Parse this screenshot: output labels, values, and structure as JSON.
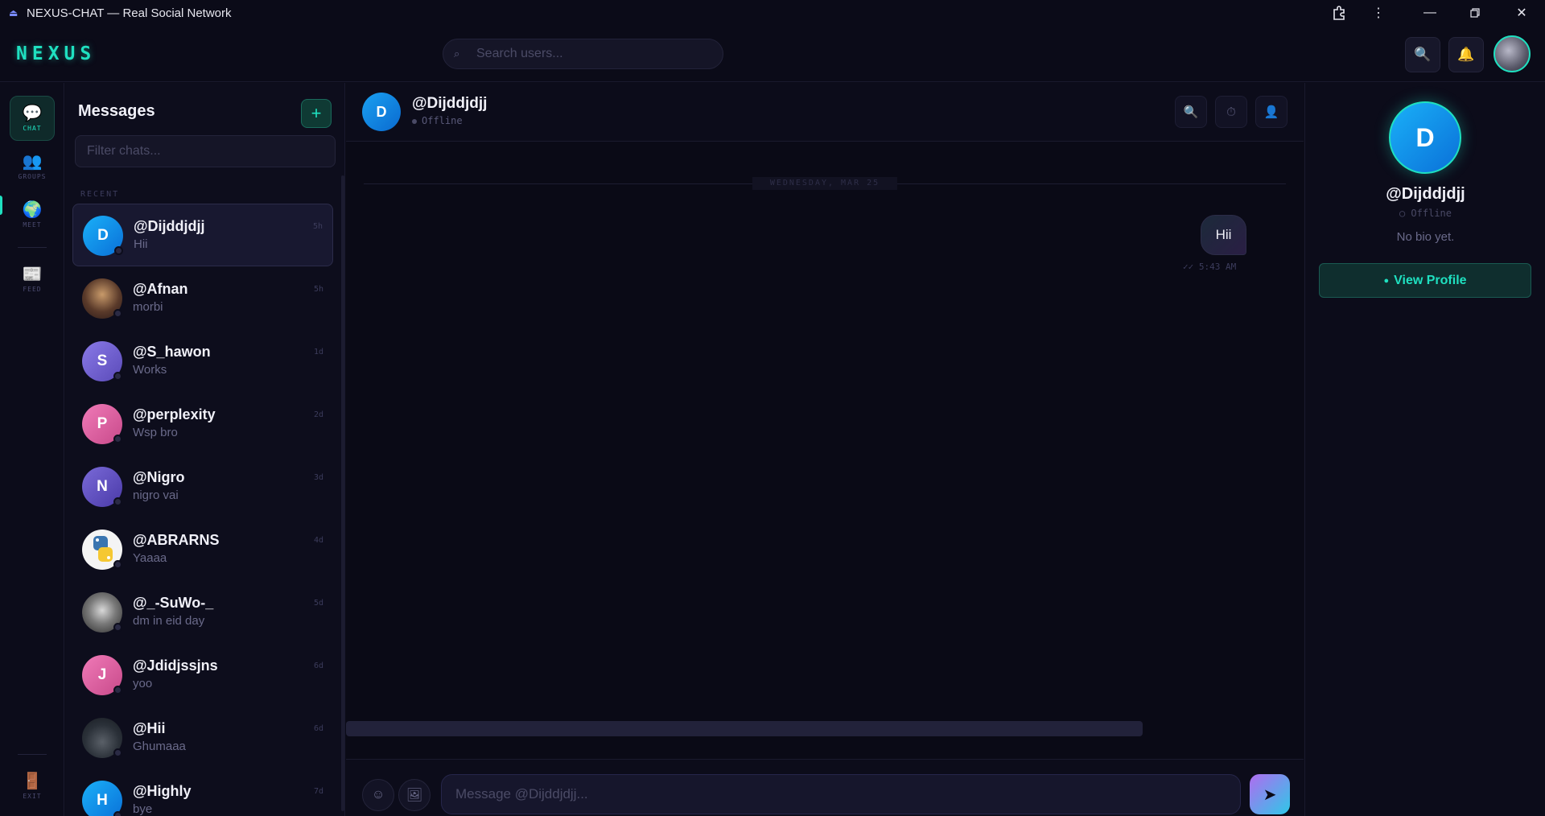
{
  "window": {
    "title": "NEXUS-CHAT — Real Social Network"
  },
  "header": {
    "logo": "NEXUS",
    "search_placeholder": "Search users...",
    "buttons": [
      "search-icon",
      "bell-icon"
    ]
  },
  "rail": {
    "items": [
      {
        "label": "CHAT",
        "icon": "speech-bubble-icon",
        "active": true
      },
      {
        "label": "GROUPS",
        "icon": "people-icon",
        "active": false
      },
      {
        "label": "MEET",
        "icon": "globe-icon",
        "active": false
      },
      {
        "label": "FEED",
        "icon": "newspaper-icon",
        "active": false
      },
      {
        "label": "EXIT",
        "icon": "door-icon",
        "active": false
      }
    ]
  },
  "chatlist": {
    "title": "Messages",
    "add_label": "+",
    "filter_placeholder": "Filter chats...",
    "section_label": "RECENT",
    "items": [
      {
        "initial": "D",
        "name": "@Dijddjdjj",
        "preview": "Hii",
        "time": "5h",
        "avatar_color": "#1aa0f0",
        "active": true
      },
      {
        "initial": "",
        "name": "@Afnan",
        "preview": "morbi",
        "time": "5h",
        "avatar_color": "#6a4a3a",
        "active": false
      },
      {
        "initial": "S",
        "name": "@S_hawon",
        "preview": "Works",
        "time": "1d",
        "avatar_color": "#7a6ad8",
        "active": false
      },
      {
        "initial": "P",
        "name": "@perplexity",
        "preview": "Wsp bro",
        "time": "2d",
        "avatar_color": "#e06aa8",
        "active": false
      },
      {
        "initial": "N",
        "name": "@Nigro",
        "preview": "nigro vai",
        "time": "3d",
        "avatar_color": "#6a5ac8",
        "active": false
      },
      {
        "initial": "",
        "name": "@ABRARNS",
        "preview": "Yaaaa",
        "time": "4d",
        "avatar_color": "#f0f0f0",
        "active": false
      },
      {
        "initial": "",
        "name": "@_-SuWo-_",
        "preview": "dm in eid day",
        "time": "5d",
        "avatar_color": "#5a5a5a",
        "active": false
      },
      {
        "initial": "J",
        "name": "@Jdidjssjns",
        "preview": "yoo",
        "time": "6d",
        "avatar_color": "#e86aa8",
        "active": false
      },
      {
        "initial": "",
        "name": "@Hii",
        "preview": "Ghumaaa",
        "time": "6d",
        "avatar_color": "#3a4048",
        "active": false
      },
      {
        "initial": "H",
        "name": "@Highly",
        "preview": "bye",
        "time": "7d",
        "avatar_color": "#1aa0f0",
        "active": false
      }
    ]
  },
  "conversation": {
    "initial": "D",
    "name": "@Dijddjdjj",
    "status": "Offline",
    "date_label": "WEDNESDAY, MAR 25",
    "messages": [
      {
        "text": "Hii",
        "meta": "✓✓ 5:43 AM",
        "outgoing": true
      }
    ],
    "composer_placeholder": "Message @Dijddjdjj..."
  },
  "profile": {
    "initial": "D",
    "name": "@Dijddjdjj",
    "status": "○ Offline",
    "bio": "No bio yet.",
    "button_label": "View Profile"
  },
  "colors": {
    "accent": "#1fe0c0",
    "background": "#0a0a16"
  }
}
